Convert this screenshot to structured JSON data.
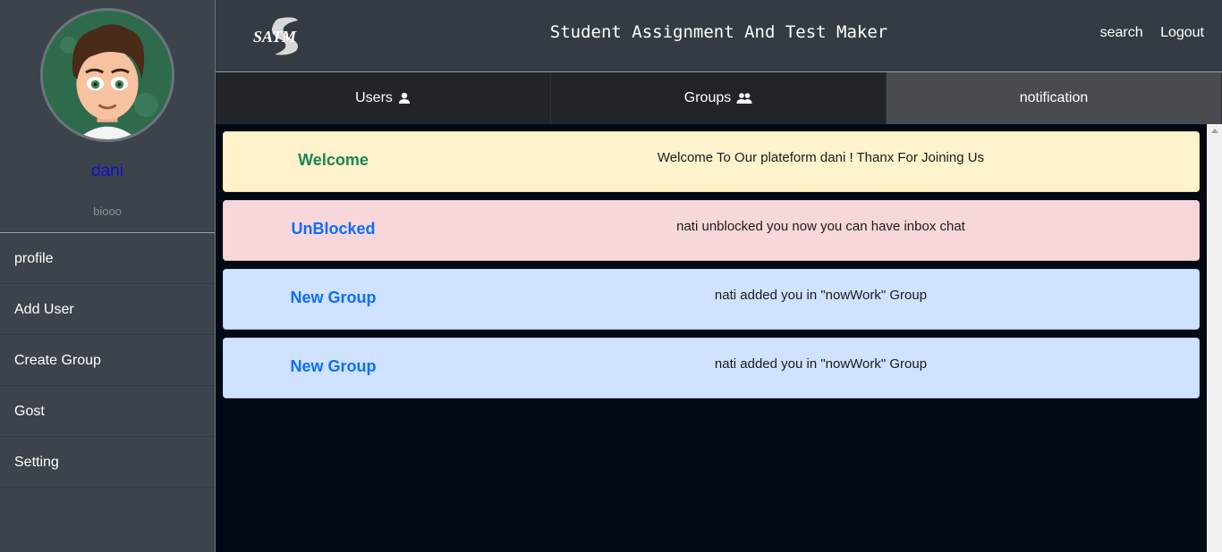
{
  "sidebar": {
    "username": "dani",
    "bio": "biooo",
    "menu": [
      {
        "label": "profile"
      },
      {
        "label": "Add User"
      },
      {
        "label": "Create Group"
      },
      {
        "label": "Gost"
      },
      {
        "label": "Setting"
      }
    ]
  },
  "header": {
    "logo_text": "SATM",
    "title": "Student Assignment And Test Maker",
    "search_label": "search",
    "logout_label": "Logout"
  },
  "tabs": [
    {
      "label": "Users",
      "icon": "user-icon"
    },
    {
      "label": "Groups",
      "icon": "users-icon"
    },
    {
      "label": "notification",
      "active": true
    }
  ],
  "notifications": [
    {
      "title": "Welcome",
      "message": "Welcome To Our plateform dani ! Thanx For Joining Us",
      "bg": "#fff3cd",
      "border": "#f0e2a8",
      "title_color": "#198754"
    },
    {
      "title": "UnBlocked",
      "message": "nati unblocked you now you can have inbox chat",
      "bg": "#f8d7da",
      "border": "#eac2c6",
      "title_color": "#0d6efd"
    },
    {
      "title": "New Group",
      "message": "nati added you in \"nowWork\" Group",
      "bg": "#cfe2ff",
      "border": "#b6d0f7",
      "title_color": "#0d6efd"
    },
    {
      "title": "New Group",
      "message": "nati added you in \"nowWork\" Group",
      "bg": "#cfe2ff",
      "border": "#b6d0f7",
      "title_color": "#0d6efd"
    }
  ]
}
